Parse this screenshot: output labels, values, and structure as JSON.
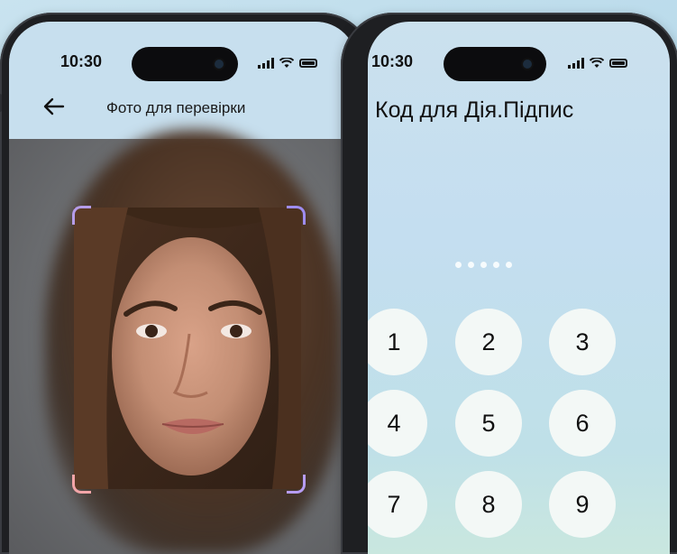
{
  "left_phone": {
    "status_time": "10:30",
    "title": "Фото для перевірки",
    "back_icon": "arrow-left-icon",
    "frame_colors": [
      "#b59ce8",
      "#9e8cf0",
      "#f2a5a8",
      "#b69cf3"
    ]
  },
  "right_phone": {
    "status_time": "10:30",
    "title": "Код для Дія.Підпис",
    "pin_length": 5,
    "keys": [
      "1",
      "2",
      "3",
      "4",
      "5",
      "6",
      "7",
      "8",
      "9"
    ]
  },
  "colors": {
    "background": "#bcdcec",
    "header": "#c7dfee",
    "key_fill": "#f3f8f6"
  }
}
